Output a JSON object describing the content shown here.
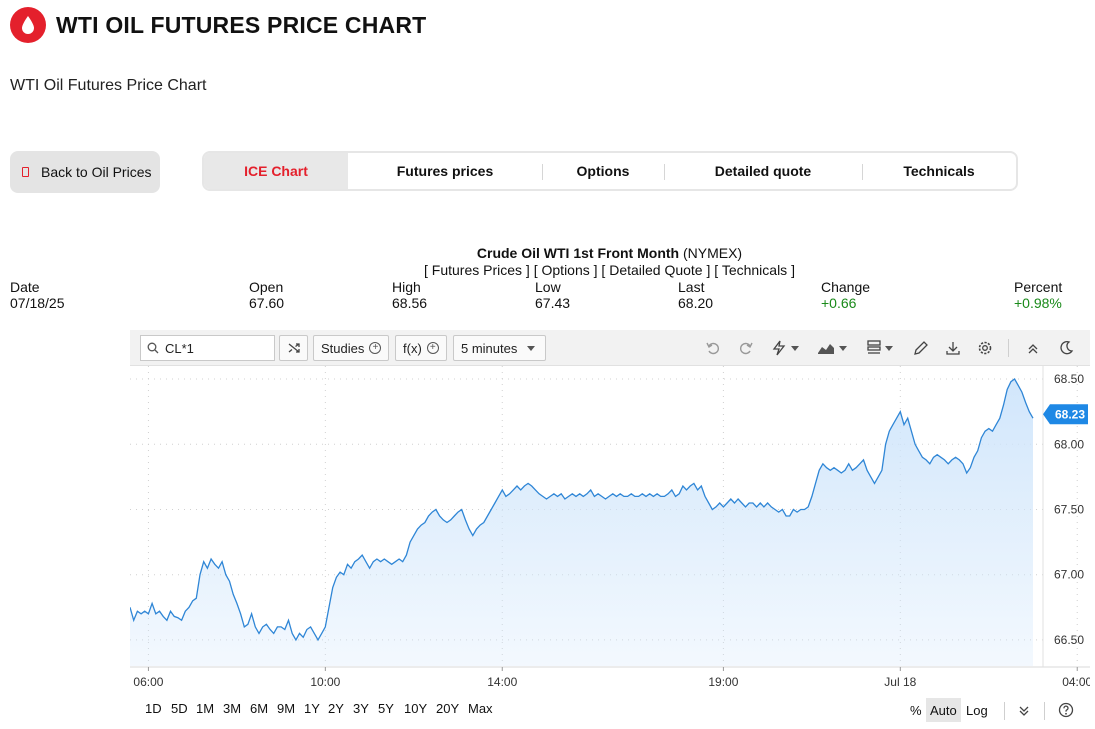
{
  "header": {
    "title": "WTI OIL FUTURES PRICE CHART",
    "subtitle": "WTI Oil Futures Price Chart",
    "logo_icon": "oil-drop-icon",
    "brand_color": "#e4202c"
  },
  "back_button": {
    "label": "Back to Oil Prices"
  },
  "tabs": [
    {
      "label": "ICE Chart",
      "active": true
    },
    {
      "label": "Futures prices"
    },
    {
      "label": "Options"
    },
    {
      "label": "Detailed quote"
    },
    {
      "label": "Technicals"
    }
  ],
  "quote": {
    "name": "Crude Oil WTI 1st Front Month",
    "exchange": "(NYMEX)",
    "links": [
      "Futures Prices",
      "Options",
      "Detailed Quote",
      "Technicals"
    ],
    "stats": [
      {
        "label": "Date",
        "value": "07/18/25"
      },
      {
        "label": "Open",
        "value": "67.60"
      },
      {
        "label": "High",
        "value": "68.56"
      },
      {
        "label": "Low",
        "value": "67.43"
      },
      {
        "label": "Last",
        "value": "68.20"
      },
      {
        "label": "Change",
        "value": "+0.66",
        "color": "#1a8a1a"
      },
      {
        "label": "Percent",
        "value": "+0.98%",
        "color": "#1a8a1a"
      }
    ]
  },
  "toolbar": {
    "search_value": "CL*1",
    "studies_label": "Studies",
    "fx_label": "f(x)",
    "interval_label": "5 minutes",
    "icons": [
      "undo-icon",
      "redo-icon",
      "lightning-icon",
      "chart-style-icon",
      "layout-icon",
      "pencil-icon",
      "download-icon",
      "gear-icon",
      "collapse-icon",
      "dark-mode-icon"
    ]
  },
  "chart_data": {
    "type": "area",
    "line_color": "#2f86d6",
    "fill_color": "#cfe5fb",
    "last_value": "68.23",
    "last_label_color": "#1e88e5",
    "ylim": [
      66.3,
      68.6
    ],
    "yticks": [
      "66.50",
      "67.00",
      "67.50",
      "68.00",
      "68.50"
    ],
    "xticks": [
      {
        "label": "06:00",
        "index": 5
      },
      {
        "label": "10:00",
        "index": 53
      },
      {
        "label": "14:00",
        "index": 101
      },
      {
        "label": "19:00",
        "index": 161
      },
      {
        "label": "Jul 18",
        "index": 209
      },
      {
        "label": "04:00",
        "index": 257
      }
    ],
    "values": [
      66.75,
      66.65,
      66.72,
      66.7,
      66.72,
      66.7,
      66.78,
      66.7,
      66.72,
      66.68,
      66.65,
      66.72,
      66.68,
      66.67,
      66.65,
      66.72,
      66.75,
      66.8,
      66.82,
      67.0,
      67.1,
      67.05,
      67.12,
      67.08,
      67.05,
      67.1,
      67.0,
      66.95,
      66.85,
      66.78,
      66.7,
      66.6,
      66.62,
      66.7,
      66.6,
      66.55,
      66.6,
      66.62,
      66.58,
      66.55,
      66.6,
      66.6,
      66.58,
      66.65,
      66.55,
      66.5,
      66.55,
      66.52,
      66.58,
      66.6,
      66.55,
      66.5,
      66.55,
      66.6,
      66.75,
      66.9,
      66.98,
      67.02,
      67.0,
      67.08,
      67.05,
      67.1,
      67.12,
      67.15,
      67.1,
      67.05,
      67.1,
      67.12,
      67.1,
      67.12,
      67.1,
      67.08,
      67.1,
      67.12,
      67.1,
      67.15,
      67.25,
      67.3,
      67.35,
      67.38,
      67.4,
      67.45,
      67.48,
      67.5,
      67.45,
      67.42,
      67.4,
      67.42,
      67.45,
      67.48,
      67.5,
      67.42,
      67.35,
      67.3,
      67.35,
      67.38,
      67.4,
      67.45,
      67.5,
      67.55,
      67.6,
      67.65,
      67.6,
      67.62,
      67.65,
      67.68,
      67.65,
      67.68,
      67.7,
      67.68,
      67.65,
      67.62,
      67.6,
      67.58,
      67.6,
      67.62,
      67.6,
      67.62,
      67.58,
      67.6,
      67.62,
      67.6,
      67.62,
      67.6,
      67.62,
      67.65,
      67.6,
      67.62,
      67.6,
      67.58,
      67.6,
      67.62,
      67.6,
      67.62,
      67.6,
      67.6,
      67.62,
      67.6,
      67.6,
      67.62,
      67.6,
      67.62,
      67.6,
      67.62,
      67.6,
      67.6,
      67.62,
      67.65,
      67.6,
      67.62,
      67.68,
      67.65,
      67.68,
      67.7,
      67.65,
      67.68,
      67.6,
      67.55,
      67.5,
      67.52,
      67.55,
      67.52,
      67.55,
      67.58,
      67.55,
      67.58,
      67.55,
      67.52,
      67.55,
      67.55,
      67.52,
      67.55,
      67.52,
      67.55,
      67.52,
      67.5,
      67.48,
      67.5,
      67.45,
      67.45,
      67.5,
      67.48,
      67.5,
      67.5,
      67.52,
      67.6,
      67.7,
      67.8,
      67.85,
      67.82,
      67.8,
      67.82,
      67.8,
      67.78,
      67.8,
      67.85,
      67.8,
      67.82,
      67.85,
      67.88,
      67.8,
      67.75,
      67.7,
      67.75,
      67.8,
      68.0,
      68.1,
      68.15,
      68.2,
      68.25,
      68.15,
      68.2,
      68.1,
      68.0,
      67.95,
      67.9,
      67.88,
      67.85,
      67.9,
      67.92,
      67.9,
      67.88,
      67.85,
      67.88,
      67.9,
      67.88,
      67.85,
      67.78,
      67.82,
      67.9,
      67.95,
      68.05,
      68.1,
      68.12,
      68.1,
      68.15,
      68.2,
      68.3,
      68.42,
      68.48,
      68.5,
      68.45,
      68.4,
      68.32,
      68.25,
      68.2
    ]
  },
  "range_buttons": [
    "1D",
    "5D",
    "1M",
    "3M",
    "6M",
    "9M",
    "1Y",
    "2Y",
    "3Y",
    "5Y",
    "10Y",
    "20Y",
    "Max"
  ],
  "scale_buttons": {
    "percent": "%",
    "auto": "Auto",
    "log": "Log"
  },
  "bottom_icons": [
    "chevrons-down-icon",
    "help-icon"
  ]
}
